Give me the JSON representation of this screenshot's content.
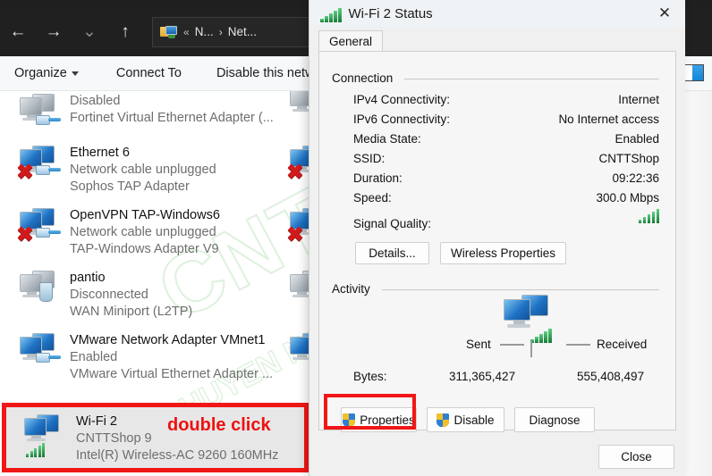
{
  "explorer": {
    "nav": {
      "back_icon": "arrow-left-icon",
      "forward_icon": "arrow-right-icon",
      "recent_icon": "chevron-down-icon",
      "up_icon": "arrow-up-icon"
    },
    "breadcrumb": {
      "overflow": "«",
      "items": [
        "N...",
        "Net..."
      ],
      "separator": "›"
    },
    "toolbar": [
      {
        "label": "Organize",
        "has_caret": true
      },
      {
        "label": "Connect To",
        "has_caret": false
      },
      {
        "label": "Disable this netw",
        "has_caret": false
      }
    ],
    "preview_toggle_icon": "preview-pane-icon",
    "watermark": {
      "line1": "CNTT",
      "line2": "CHUYEN NGHIEP - THAN THIEN"
    },
    "adapters": [
      {
        "name": "",
        "status": "Disabled",
        "device": "Fortinet Virtual Ethernet Adapter (...",
        "icon": "network-adapter-disabled-icon",
        "screen": "off",
        "error": false,
        "connector": "plug"
      },
      {
        "name": "Ethernet 6",
        "status": "Network cable unplugged",
        "device": "Sophos TAP Adapter",
        "icon": "network-adapter-icon",
        "screen": "on",
        "error": true,
        "connector": "plug"
      },
      {
        "name": "OpenVPN TAP-Windows6",
        "status": "Network cable unplugged",
        "device": "TAP-Windows Adapter V9",
        "icon": "network-adapter-icon",
        "screen": "on",
        "error": true,
        "connector": "plug"
      },
      {
        "name": "pantio",
        "status": "Disconnected",
        "device": "WAN Miniport (L2TP)",
        "icon": "network-adapter-disconnected-icon",
        "screen": "off",
        "error": false,
        "connector": "server"
      },
      {
        "name": "VMware Network Adapter VMnet1",
        "status": "Enabled",
        "device": "VMware Virtual Ethernet Adapter ...",
        "icon": "network-adapter-icon",
        "screen": "on",
        "error": false,
        "connector": "plug"
      }
    ],
    "selected_adapter": {
      "name": "Wi-Fi 2",
      "status": "CNTTShop 9",
      "device": "Intel(R) Wireless-AC 9260 160MHz",
      "annotation": "double click",
      "annotation_color": "#ee1111",
      "highlight_color": "#f01717"
    }
  },
  "dialog": {
    "title": "Wi-Fi 2 Status",
    "title_icon": "wifi-signal-icon",
    "close_icon": "✕",
    "tabs": [
      {
        "label": "General",
        "selected": true
      }
    ],
    "connection": {
      "group_label": "Connection",
      "rows": [
        {
          "label": "IPv4 Connectivity:",
          "value": "Internet"
        },
        {
          "label": "IPv6 Connectivity:",
          "value": "No Internet access"
        },
        {
          "label": "Media State:",
          "value": "Enabled"
        },
        {
          "label": "SSID:",
          "value": "CNTTShop"
        },
        {
          "label": "Duration:",
          "value": "09:22:36"
        },
        {
          "label": "Speed:",
          "value": "300.0 Mbps"
        }
      ],
      "signal_quality_label": "Signal Quality:",
      "signal_quality_bars": 5,
      "signal_color": "#177a37",
      "buttons": [
        {
          "label": "Details...",
          "shield": false
        },
        {
          "label": "Wireless Properties",
          "shield": false
        }
      ]
    },
    "activity": {
      "group_label": "Activity",
      "sent_label": "Sent",
      "received_label": "Received",
      "bytes_label": "Bytes:",
      "bytes_sent": "311,365,427",
      "bytes_received": "555,408,497",
      "icon": "two-computers-icon"
    },
    "action_buttons": [
      {
        "label": "Properties",
        "shield": true,
        "highlighted": true
      },
      {
        "label": "Disable",
        "shield": true,
        "highlighted": false
      },
      {
        "label": "Diagnose",
        "shield": false,
        "highlighted": false
      }
    ],
    "close_button": {
      "label": "Close"
    }
  }
}
